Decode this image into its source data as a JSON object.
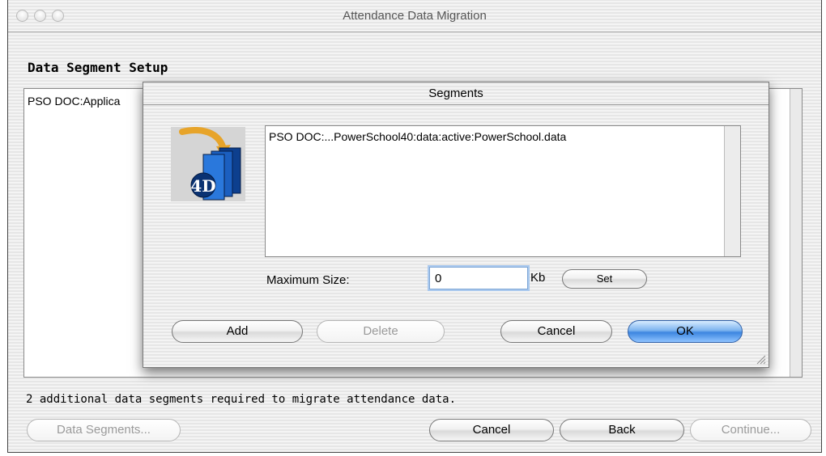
{
  "window": {
    "title": "Attendance Data Migration"
  },
  "section": {
    "heading": "Data Segment Setup"
  },
  "background": {
    "list_item": "PSO DOC:Applica",
    "status": "2 additional data segments required to migrate attendance data.",
    "buttons": {
      "data_segments": "Data Segments...",
      "cancel": "Cancel",
      "back": "Back",
      "continue": "Continue..."
    }
  },
  "dialog": {
    "title": "Segments",
    "icon": "4d-database-icon",
    "segment_path": "PSO DOC:...PowerSchool40:data:active:PowerSchool.data",
    "max_size_label": "Maximum Size:",
    "max_size_value": "0",
    "unit": "Kb",
    "buttons": {
      "set": "Set",
      "add": "Add",
      "delete": "Delete",
      "cancel": "Cancel",
      "ok": "OK"
    }
  },
  "colors": {
    "default_button": "#3d86e0",
    "window_background": "#eeeeee"
  }
}
